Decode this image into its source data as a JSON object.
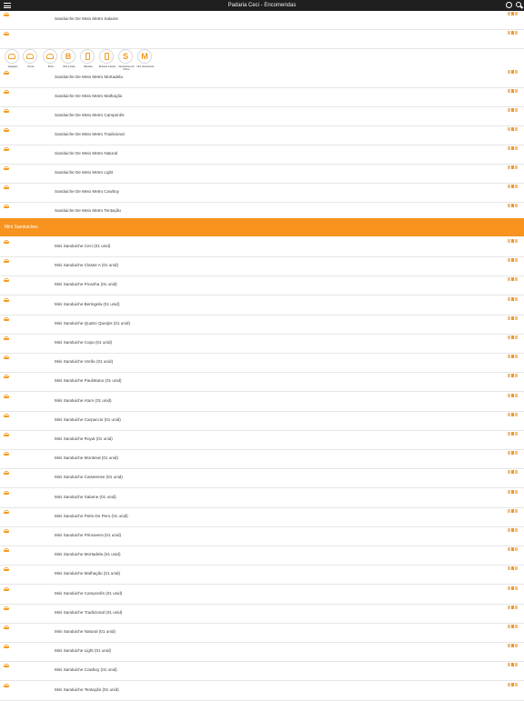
{
  "header": {
    "title": "Padaria Ceci - Encomendas"
  },
  "categories": [
    {
      "label": "Salgados",
      "icon": "pastry-icon",
      "glyph": ""
    },
    {
      "label": "Doces",
      "icon": "cake-icon",
      "glyph": ""
    },
    {
      "label": "Bolos",
      "icon": "bread-icon",
      "glyph": ""
    },
    {
      "label": "Bolos Fatia",
      "icon": "letter-b-icon",
      "glyph": "B"
    },
    {
      "label": "Bebidas",
      "icon": "bottle-icon",
      "glyph": ""
    },
    {
      "label": "Bebidas Inteiras",
      "icon": "jar-icon",
      "glyph": ""
    },
    {
      "label": "Sanduiches De Metro",
      "icon": "letter-s-icon",
      "glyph": "S"
    },
    {
      "label": "Mini Sanduiches",
      "icon": "letter-m-icon",
      "glyph": "M"
    }
  ],
  "top_items": [
    "Sanduiche De Meio Metro Salame",
    "",
    "Sanduiche De Meio Metro Mortadela",
    "Sanduiche De Meio Metro Malhação",
    "Sanduiche De Meio Metro Camponês",
    "Sanduiche De Meio Metro Tradicional",
    "Sanduiche De Meio Metro Natural",
    "Sanduiche De Meio Metro Light",
    "Sanduiche De Meio Metro Cowboy",
    "Sanduiche De Meio Metro Tentação"
  ],
  "section": {
    "label": "Mini Sanduiches"
  },
  "mini_items": [
    "Mini Sanduiche Ceci (01 unid)",
    "Mini Sanduiche Classe A (01 unid)",
    "Mini Sanduiche Picanha (01 unid)",
    "Mini Sanduiche Beringela (01 unid)",
    "Mini Sanduiche Quatro Queijos (01 unid)",
    "Mini Sanduiche Copa (01 unid)",
    "Mini Sanduiche Verão (01 unid)",
    "Mini Sanduiche Paulistano (01 unid)",
    "Mini Sanduiche Atum (01 unid)",
    "Mini Sanduiche Carpaccio (01 unid)",
    "Mini Sanduiche Royal (01 unid)",
    "Mini Sanduiche Montreal (01 unid)",
    "Mini Sanduiche Caiseiense (01 unid)",
    "Mini Sanduiche Salame (01 unid)",
    "Mini Sanduiche Peito De Peru (01 unid)",
    "Mini Sanduiche Primavera (01 unid)",
    "Mini Sanduiche Mortadela (01 unid)",
    "Mini Sanduiche Malhação (01 unid)",
    "Mini Sanduiche Camponês (01 unid)",
    "Mini Sanduiche Tradicional (01 unid)",
    "Mini Sanduiche Natural (01 unid)",
    "Mini Sanduiche Light (01 unid)",
    "Mini Sanduiche Cowboy (01 unid)",
    "Mini Sanduiche Tentação (01 unid)"
  ],
  "colors": {
    "accent": "#f7931e",
    "header": "#1f1f1f",
    "divider": "#e6e6e6"
  }
}
